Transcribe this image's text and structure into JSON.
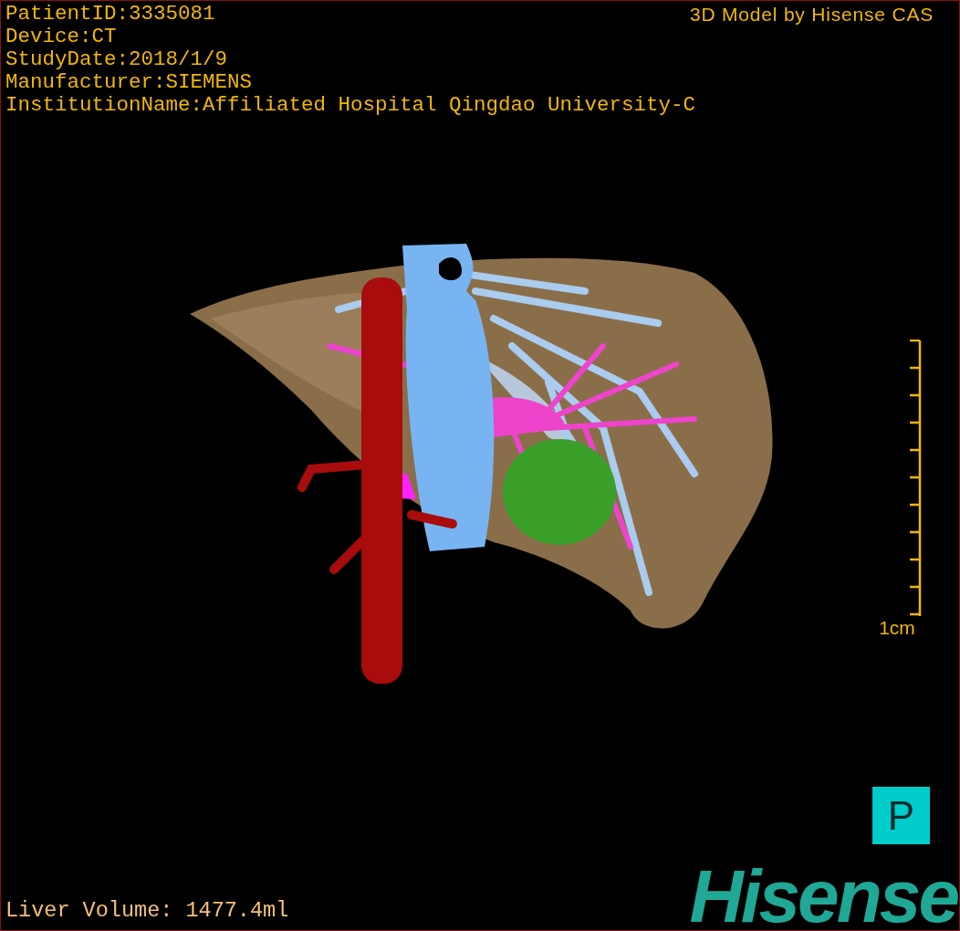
{
  "info_lines": [
    "PatientID:3335081",
    "Device:CT",
    "StudyDate:2018/1/9",
    "Manufacturer:SIEMENS",
    "InstitutionName:Affiliated Hospital Qingdao University-C"
  ],
  "title": "3D Model by Hisense CAS",
  "scale": {
    "label": "1cm"
  },
  "orientation": {
    "label": "P"
  },
  "liver_volume": "Liver Volume: 1477.4ml",
  "logo": "Hisense"
}
